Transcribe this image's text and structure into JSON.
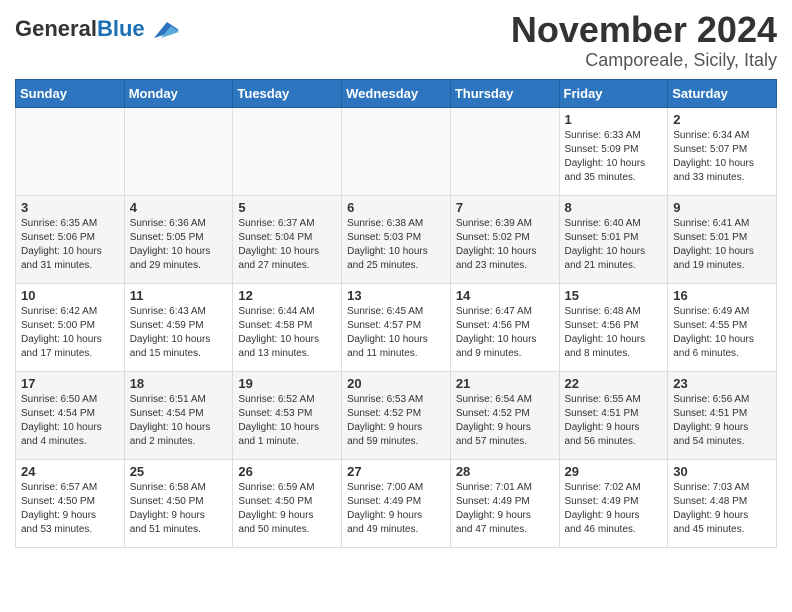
{
  "header": {
    "logo_general": "General",
    "logo_blue": "Blue",
    "title": "November 2024",
    "subtitle": "Camporeale, Sicily, Italy"
  },
  "weekdays": [
    "Sunday",
    "Monday",
    "Tuesday",
    "Wednesday",
    "Thursday",
    "Friday",
    "Saturday"
  ],
  "weeks": [
    [
      {
        "day": "",
        "info": ""
      },
      {
        "day": "",
        "info": ""
      },
      {
        "day": "",
        "info": ""
      },
      {
        "day": "",
        "info": ""
      },
      {
        "day": "",
        "info": ""
      },
      {
        "day": "1",
        "info": "Sunrise: 6:33 AM\nSunset: 5:09 PM\nDaylight: 10 hours\nand 35 minutes."
      },
      {
        "day": "2",
        "info": "Sunrise: 6:34 AM\nSunset: 5:07 PM\nDaylight: 10 hours\nand 33 minutes."
      }
    ],
    [
      {
        "day": "3",
        "info": "Sunrise: 6:35 AM\nSunset: 5:06 PM\nDaylight: 10 hours\nand 31 minutes."
      },
      {
        "day": "4",
        "info": "Sunrise: 6:36 AM\nSunset: 5:05 PM\nDaylight: 10 hours\nand 29 minutes."
      },
      {
        "day": "5",
        "info": "Sunrise: 6:37 AM\nSunset: 5:04 PM\nDaylight: 10 hours\nand 27 minutes."
      },
      {
        "day": "6",
        "info": "Sunrise: 6:38 AM\nSunset: 5:03 PM\nDaylight: 10 hours\nand 25 minutes."
      },
      {
        "day": "7",
        "info": "Sunrise: 6:39 AM\nSunset: 5:02 PM\nDaylight: 10 hours\nand 23 minutes."
      },
      {
        "day": "8",
        "info": "Sunrise: 6:40 AM\nSunset: 5:01 PM\nDaylight: 10 hours\nand 21 minutes."
      },
      {
        "day": "9",
        "info": "Sunrise: 6:41 AM\nSunset: 5:01 PM\nDaylight: 10 hours\nand 19 minutes."
      }
    ],
    [
      {
        "day": "10",
        "info": "Sunrise: 6:42 AM\nSunset: 5:00 PM\nDaylight: 10 hours\nand 17 minutes."
      },
      {
        "day": "11",
        "info": "Sunrise: 6:43 AM\nSunset: 4:59 PM\nDaylight: 10 hours\nand 15 minutes."
      },
      {
        "day": "12",
        "info": "Sunrise: 6:44 AM\nSunset: 4:58 PM\nDaylight: 10 hours\nand 13 minutes."
      },
      {
        "day": "13",
        "info": "Sunrise: 6:45 AM\nSunset: 4:57 PM\nDaylight: 10 hours\nand 11 minutes."
      },
      {
        "day": "14",
        "info": "Sunrise: 6:47 AM\nSunset: 4:56 PM\nDaylight: 10 hours\nand 9 minutes."
      },
      {
        "day": "15",
        "info": "Sunrise: 6:48 AM\nSunset: 4:56 PM\nDaylight: 10 hours\nand 8 minutes."
      },
      {
        "day": "16",
        "info": "Sunrise: 6:49 AM\nSunset: 4:55 PM\nDaylight: 10 hours\nand 6 minutes."
      }
    ],
    [
      {
        "day": "17",
        "info": "Sunrise: 6:50 AM\nSunset: 4:54 PM\nDaylight: 10 hours\nand 4 minutes."
      },
      {
        "day": "18",
        "info": "Sunrise: 6:51 AM\nSunset: 4:54 PM\nDaylight: 10 hours\nand 2 minutes."
      },
      {
        "day": "19",
        "info": "Sunrise: 6:52 AM\nSunset: 4:53 PM\nDaylight: 10 hours\nand 1 minute."
      },
      {
        "day": "20",
        "info": "Sunrise: 6:53 AM\nSunset: 4:52 PM\nDaylight: 9 hours\nand 59 minutes."
      },
      {
        "day": "21",
        "info": "Sunrise: 6:54 AM\nSunset: 4:52 PM\nDaylight: 9 hours\nand 57 minutes."
      },
      {
        "day": "22",
        "info": "Sunrise: 6:55 AM\nSunset: 4:51 PM\nDaylight: 9 hours\nand 56 minutes."
      },
      {
        "day": "23",
        "info": "Sunrise: 6:56 AM\nSunset: 4:51 PM\nDaylight: 9 hours\nand 54 minutes."
      }
    ],
    [
      {
        "day": "24",
        "info": "Sunrise: 6:57 AM\nSunset: 4:50 PM\nDaylight: 9 hours\nand 53 minutes."
      },
      {
        "day": "25",
        "info": "Sunrise: 6:58 AM\nSunset: 4:50 PM\nDaylight: 9 hours\nand 51 minutes."
      },
      {
        "day": "26",
        "info": "Sunrise: 6:59 AM\nSunset: 4:50 PM\nDaylight: 9 hours\nand 50 minutes."
      },
      {
        "day": "27",
        "info": "Sunrise: 7:00 AM\nSunset: 4:49 PM\nDaylight: 9 hours\nand 49 minutes."
      },
      {
        "day": "28",
        "info": "Sunrise: 7:01 AM\nSunset: 4:49 PM\nDaylight: 9 hours\nand 47 minutes."
      },
      {
        "day": "29",
        "info": "Sunrise: 7:02 AM\nSunset: 4:49 PM\nDaylight: 9 hours\nand 46 minutes."
      },
      {
        "day": "30",
        "info": "Sunrise: 7:03 AM\nSunset: 4:48 PM\nDaylight: 9 hours\nand 45 minutes."
      }
    ]
  ]
}
